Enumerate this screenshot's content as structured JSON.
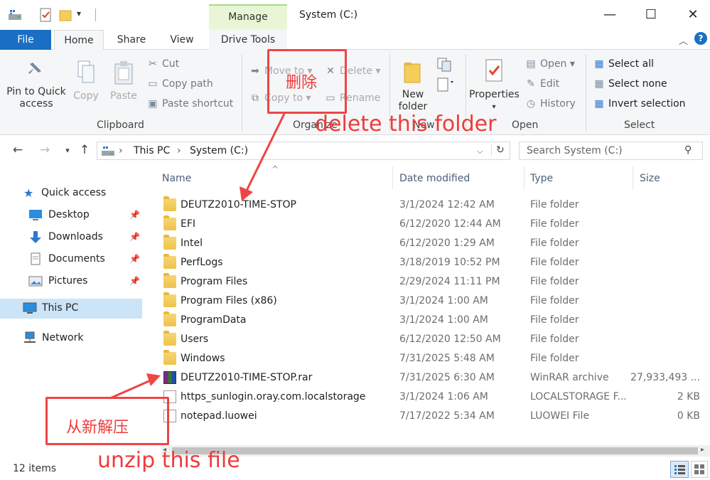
{
  "window": {
    "title": "System (C:)",
    "manage_tab": "Manage",
    "minimize": "—",
    "maximize": "☐",
    "close": "✕"
  },
  "tabs": {
    "file": "File",
    "home": "Home",
    "share": "Share",
    "view": "View",
    "drive_tools": "Drive Tools"
  },
  "ribbon": {
    "clipboard": {
      "pin": "Pin to Quick access",
      "copy": "Copy",
      "paste": "Paste",
      "cut": "Cut",
      "copy_path": "Copy path",
      "paste_shortcut": "Paste shortcut",
      "label": "Clipboard"
    },
    "organize": {
      "move_to": "Move to",
      "copy_to": "Copy to",
      "delete": "Delete",
      "rename": "Rename",
      "label": "Organize"
    },
    "new": {
      "new_folder": "New folder",
      "label": "New"
    },
    "open": {
      "properties": "Properties",
      "open": "Open",
      "edit": "Edit",
      "history": "History",
      "label": "Open"
    },
    "select": {
      "select_all": "Select all",
      "select_none": "Select none",
      "invert": "Invert selection",
      "label": "Select"
    }
  },
  "address": {
    "crumbs": [
      "This PC",
      "System (C:)"
    ],
    "search_placeholder": "Search System (C:)"
  },
  "nav": {
    "quick_access": "Quick access",
    "desktop": "Desktop",
    "downloads": "Downloads",
    "documents": "Documents",
    "pictures": "Pictures",
    "this_pc": "This PC",
    "network": "Network"
  },
  "columns": {
    "name": "Name",
    "date": "Date modified",
    "type": "Type",
    "size": "Size"
  },
  "files": [
    {
      "name": "DEUTZ2010-TIME-STOP",
      "date": "3/1/2024 12:42 AM",
      "type": "File folder",
      "size": "",
      "icon": "folder-icon"
    },
    {
      "name": "EFI",
      "date": "6/12/2020 12:44 AM",
      "type": "File folder",
      "size": "",
      "icon": "folder-icon"
    },
    {
      "name": "Intel",
      "date": "6/12/2020 1:29 AM",
      "type": "File folder",
      "size": "",
      "icon": "folder-icon"
    },
    {
      "name": "PerfLogs",
      "date": "3/18/2019 10:52 PM",
      "type": "File folder",
      "size": "",
      "icon": "folder-icon"
    },
    {
      "name": "Program Files",
      "date": "2/29/2024 11:11 PM",
      "type": "File folder",
      "size": "",
      "icon": "folder-icon"
    },
    {
      "name": "Program Files (x86)",
      "date": "3/1/2024 1:00 AM",
      "type": "File folder",
      "size": "",
      "icon": "folder-icon"
    },
    {
      "name": "ProgramData",
      "date": "3/1/2024 1:00 AM",
      "type": "File folder",
      "size": "",
      "icon": "folder-icon"
    },
    {
      "name": "Users",
      "date": "6/12/2020 12:50 AM",
      "type": "File folder",
      "size": "",
      "icon": "folder-icon"
    },
    {
      "name": "Windows",
      "date": "7/31/2025 5:48 AM",
      "type": "File folder",
      "size": "",
      "icon": "folder-icon"
    },
    {
      "name": "DEUTZ2010-TIME-STOP.rar",
      "date": "7/31/2025 6:30 AM",
      "type": "WinRAR archive",
      "size": "27,933,493 ...",
      "icon": "rar-icon"
    },
    {
      "name": "https_sunlogin.oray.com.localstorage",
      "date": "3/1/2024 1:06 AM",
      "type": "LOCALSTORAGE F...",
      "size": "2 KB",
      "icon": "document-icon"
    },
    {
      "name": "notepad.luowei",
      "date": "7/17/2022 5:34 AM",
      "type": "LUOWEI File",
      "size": "0 KB",
      "icon": "document-icon"
    }
  ],
  "status": {
    "count": "12 items"
  },
  "annotations": {
    "delete_cn": "删除",
    "delete_en": "delete this folder",
    "unzip_cn": "从新解压",
    "unzip_en": "unzip this file",
    "color": "#ef4444"
  }
}
